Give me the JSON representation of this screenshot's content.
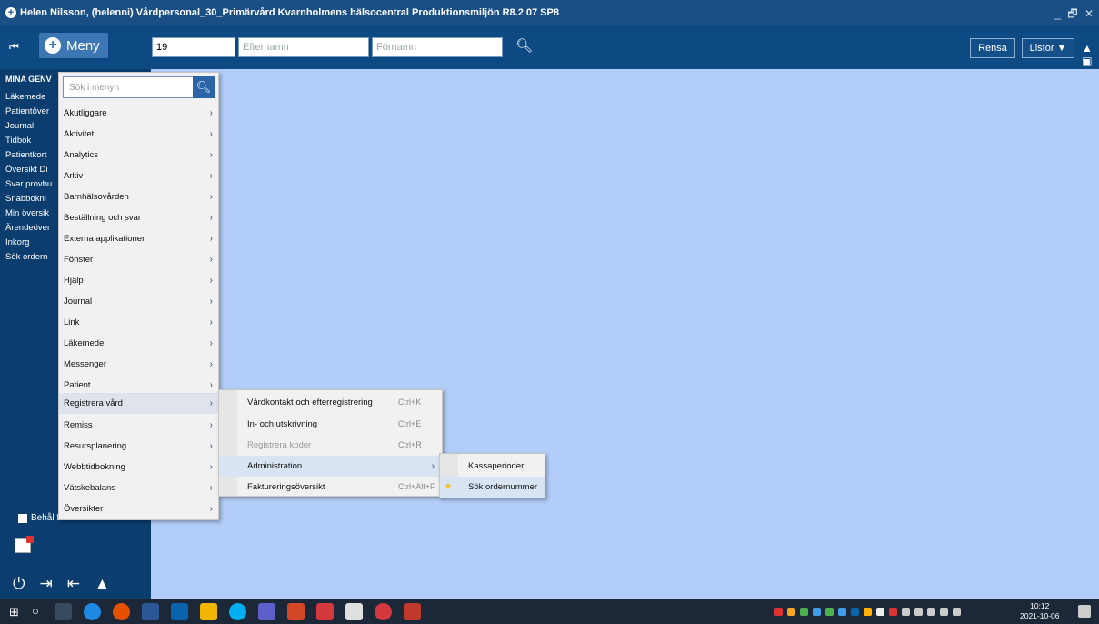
{
  "window": {
    "title": "Helen  Nilsson, (helenni) Vårdpersonal_30_Primärvård Kvarnholmens hälsocentral Produktionsmiljön R8.2 07 SP8",
    "controls": "_ 🗗 ✕"
  },
  "toolbar": {
    "first_icon": "first-page-icon",
    "meny_label": "Meny",
    "personnummer_value": "19",
    "efternamn_placeholder": "Efternamn",
    "fornamn_placeholder": "Förnamn",
    "rensa_label": "Rensa",
    "listor_label": "Listor ▼"
  },
  "sidebar": {
    "favorites_title": "MINA GENV",
    "items": [
      "Läkemede",
      "Patientöver",
      "Journal",
      "Tidbok",
      "Patientkort",
      "Översikt Di",
      "Svar provbu",
      "Snabbokni",
      "Min översik",
      "Ärendeöver",
      "Inkorg",
      "Sök ordern"
    ],
    "keep_open_label": "Behål fönster"
  },
  "menu": {
    "search_placeholder": "Sök i menyn",
    "items": [
      {
        "label": "Akutliggare"
      },
      {
        "label": "Aktivitet"
      },
      {
        "label": "Analytics"
      },
      {
        "label": "Arkiv"
      },
      {
        "label": "Barnhälsovården"
      },
      {
        "label": "Beställning och svar"
      },
      {
        "label": "Externa applikationer"
      },
      {
        "label": "Fönster"
      },
      {
        "label": "Hjälp"
      },
      {
        "label": "Journal"
      },
      {
        "label": "Link"
      },
      {
        "label": "Läkemedel"
      },
      {
        "label": "Messenger"
      },
      {
        "label": "Patient"
      },
      {
        "label": "Registrera vård"
      },
      {
        "label": "Remiss"
      },
      {
        "label": "Resursplanering"
      },
      {
        "label": "Webbtidbokning"
      },
      {
        "label": "Vätskebalans"
      },
      {
        "label": "Översikter"
      }
    ]
  },
  "submenu_registrera": [
    {
      "label": "Vårdkontakt och efterregistrering",
      "shortcut": "Ctrl+K"
    },
    {
      "label": "In- och utskrivning",
      "shortcut": "Ctrl+E"
    },
    {
      "label": "Registrera koder",
      "shortcut": "Ctrl+R"
    },
    {
      "label": "Administration",
      "shortcut": ""
    },
    {
      "label": "Faktureringsöversikt",
      "shortcut": "Ctrl+Alt+F"
    }
  ],
  "submenu_administration": [
    {
      "label": "Kassaperioder"
    },
    {
      "label": "Sök ordernummer"
    }
  ],
  "taskbar": {
    "time": "10:12",
    "date": "2021-10-06"
  },
  "colors": {
    "titlebar": "#1a4f86",
    "toolbar": "#0d4a84",
    "sidebar": "#0b3d6e",
    "workspace": "#b2cdf8",
    "menu_bg": "#f1f1f1",
    "menu_hover": "#dfe4ec",
    "accent": "#2c64a8"
  }
}
